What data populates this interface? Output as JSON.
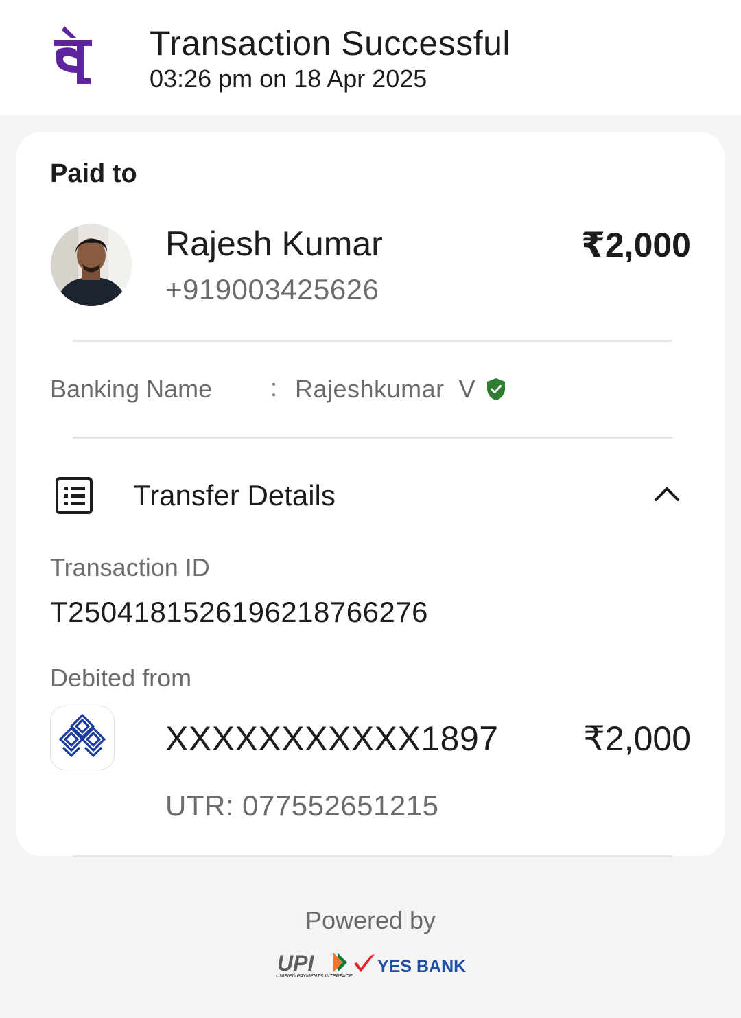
{
  "header": {
    "title": "Transaction Successful",
    "timestamp": "03:26 pm on 18 Apr 2025",
    "logo_icon": "phonepe-logo",
    "brand_color": "#5f259f"
  },
  "payee": {
    "section_title": "Paid to",
    "name": "Rajesh Kumar",
    "phone": "+919003425626",
    "amount": "₹2,000"
  },
  "banking": {
    "label": "Banking Name",
    "separator": ":",
    "name": "Rajeshkumar  V",
    "verified_icon": "verified-shield-icon",
    "verified_color": "#2e7d32"
  },
  "transfer": {
    "title": "Transfer Details",
    "icon": "receipt-list-icon",
    "toggle_icon": "chevron-up-icon",
    "transaction_id_label": "Transaction ID",
    "transaction_id": "T2504181526196218766276",
    "debited_from_label": "Debited from",
    "account": "XXXXXXXXXXX1897",
    "debit_amount": "₹2,000",
    "utr": "UTR: 077552651215",
    "bank_logo_icon": "bank-logo-icon"
  },
  "footer": {
    "powered_by": "Powered by",
    "upi_logo_text": "UPI",
    "upi_subtext": "UNIFIED PAYMENTS INTERFACE",
    "partner_bank": "YES BANK"
  }
}
